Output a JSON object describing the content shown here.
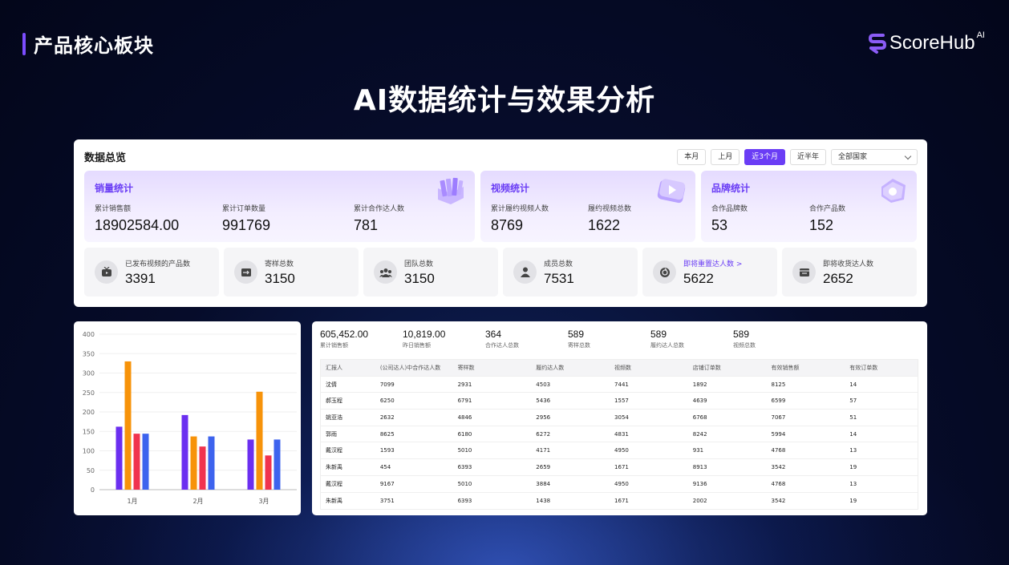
{
  "corner_title": "产品核心板块",
  "logo": {
    "text": "ScoreHub",
    "sup": "AI"
  },
  "main_title": "AI数据统计与效果分析",
  "overview": {
    "title": "数据总览",
    "filters": [
      "本月",
      "上月",
      "近3个月",
      "近半年"
    ],
    "active_filter": "近3个月",
    "country_select": "全部国家",
    "sales": {
      "title": "销量统计",
      "items": [
        {
          "label": "累计销售额",
          "value": "18902584.00"
        },
        {
          "label": "累计订单数量",
          "value": "991769"
        },
        {
          "label": "累计合作达人数",
          "value": "781"
        }
      ]
    },
    "video": {
      "title": "视频统计",
      "items": [
        {
          "label": "累计履约视频人数",
          "value": "8769"
        },
        {
          "label": "履约视频总数",
          "value": "1622"
        }
      ]
    },
    "brand": {
      "title": "品牌统计",
      "items": [
        {
          "label": "合作品牌数",
          "value": "53"
        },
        {
          "label": "合作产品数",
          "value": "152"
        }
      ]
    },
    "mini": [
      {
        "label": "已发布视频的产品数",
        "value": "3391",
        "icon": "tv-icon"
      },
      {
        "label": "寄样总数",
        "value": "3150",
        "icon": "sample-box-icon"
      },
      {
        "label": "团队总数",
        "value": "3150",
        "icon": "team-icon"
      },
      {
        "label": "成员总数",
        "value": "7531",
        "icon": "member-icon"
      },
      {
        "label": "即将重置达人数 >",
        "value": "5622",
        "icon": "reset-icon"
      },
      {
        "label": "即将收货达人数",
        "value": "2652",
        "icon": "receive-box-icon"
      }
    ]
  },
  "chart_data": {
    "type": "bar",
    "categories": [
      "1月",
      "2月",
      "3月"
    ],
    "series": [
      {
        "values": [
          162,
          192,
          129
        ],
        "color": "#6b2ff0"
      },
      {
        "values": [
          330,
          137,
          252
        ],
        "color": "#f7930a"
      },
      {
        "values": [
          144,
          111,
          88
        ],
        "color": "#f0334e"
      },
      {
        "values": [
          144,
          137,
          129
        ],
        "color": "#3d63ee"
      }
    ],
    "yticks": [
      "0",
      "50",
      "100",
      "150",
      "200",
      "250",
      "300",
      "350",
      "400"
    ],
    "ylim": [
      0,
      400
    ],
    "grid": true
  },
  "kpis": [
    {
      "value": "605,452.00",
      "label": "累计销售额"
    },
    {
      "value": "10,819.00",
      "label": "昨日销售额"
    },
    {
      "value": "364",
      "label": "合作达人总数"
    },
    {
      "value": "589",
      "label": "寄样总数"
    },
    {
      "value": "589",
      "label": "履约达人总数"
    },
    {
      "value": "589",
      "label": "视频总数"
    }
  ],
  "table": {
    "columns": [
      "汇报人",
      "(公司达人)中合作达人数",
      "寄样数",
      "履约达人数",
      "视频数",
      "店铺订单数",
      "有效销售额",
      "有效订单数"
    ],
    "rows": [
      [
        "沈倩",
        "7099",
        "2931",
        "4503",
        "7441",
        "1892",
        "8125",
        "14"
      ],
      [
        "郝玉程",
        "6250",
        "6791",
        "5436",
        "1557",
        "4639",
        "6599",
        "57"
      ],
      [
        "姚亚浩",
        "2632",
        "4846",
        "2956",
        "3054",
        "6768",
        "7067",
        "51"
      ],
      [
        "郭雨",
        "8625",
        "6180",
        "6272",
        "4831",
        "8242",
        "5994",
        "14"
      ],
      [
        "戴汉程",
        "1593",
        "5010",
        "4171",
        "4950",
        "931",
        "4768",
        "13"
      ],
      [
        "朱新禹",
        "454",
        "6393",
        "2659",
        "1671",
        "8913",
        "3542",
        "19"
      ],
      [
        "戴汉程",
        "9167",
        "5010",
        "3884",
        "4950",
        "9136",
        "4768",
        "13"
      ],
      [
        "朱新禹",
        "3751",
        "6393",
        "1438",
        "1671",
        "2002",
        "3542",
        "19"
      ]
    ]
  }
}
